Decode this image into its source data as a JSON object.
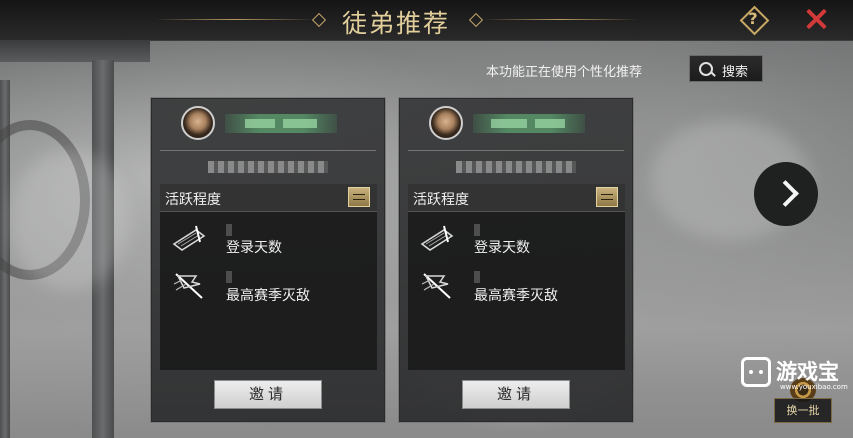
{
  "header": {
    "title": "徒弟推荐"
  },
  "toolbar": {
    "notice": "本功能正在使用个性化推荐",
    "search_label": "搜索"
  },
  "cards": [
    {
      "stats_title": "活跃程度",
      "stat_login": "登录天数",
      "stat_kills": "最高赛季灭敌",
      "invite_label": "邀请"
    },
    {
      "stats_title": "活跃程度",
      "stat_login": "登录天数",
      "stat_kills": "最高赛季灭敌",
      "invite_label": "邀请"
    }
  ],
  "footer": {
    "refresh_label": "换一批"
  },
  "watermark": {
    "text": "游戏宝",
    "url": "www.youxibao.com"
  },
  "icons": {
    "help": "question-diamond-icon",
    "close": "close-x-icon",
    "search": "magnifier-icon",
    "swap": "swap-arrows-icon",
    "login": "scroll-quill-icon",
    "kills": "battle-flag-icon",
    "next": "chevron-right-icon",
    "refresh": "refresh-coin-icon"
  },
  "colors": {
    "title_gold": "#e2cf9c",
    "close_red": "#d23a3a",
    "name_green": "#5aa06e"
  }
}
